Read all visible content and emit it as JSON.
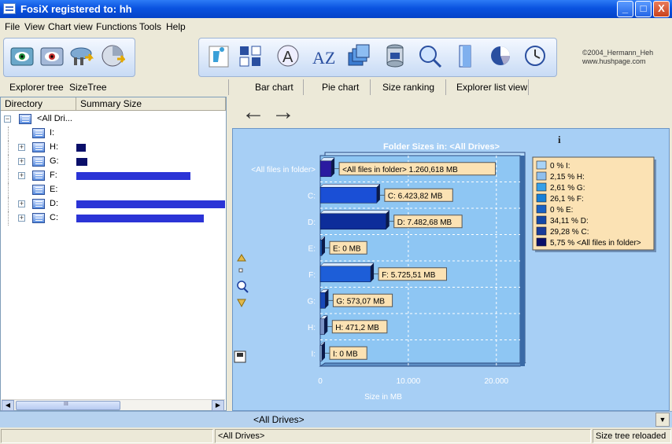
{
  "window": {
    "title": "FosiX registered to: hh",
    "minimize": "_",
    "maximize": "□",
    "close": "X"
  },
  "menu": [
    "File",
    "View",
    "Chart view",
    "Functions",
    "Tools",
    "Help"
  ],
  "toolbar": {
    "copyright_line1": "©2004_Hermann_Heh",
    "copyright_line2": "www.hushpage.com"
  },
  "left_tabs": [
    "Explorer tree",
    "SizeTree"
  ],
  "right_tabs": [
    "Bar chart",
    "Pie chart",
    "Size ranking",
    "Explorer list view"
  ],
  "tree": {
    "columns": [
      "Directory",
      "Summary Size"
    ],
    "root": "<All Dri...",
    "items": [
      {
        "label": "I:",
        "expander": "",
        "fraction": 0
      },
      {
        "label": "H:",
        "expander": "+",
        "fraction": 0.0215
      },
      {
        "label": "G:",
        "expander": "+",
        "fraction": 0.0261
      },
      {
        "label": "F:",
        "expander": "+",
        "fraction": 0.261
      },
      {
        "label": "E:",
        "expander": "",
        "fraction": 0
      },
      {
        "label": "D:",
        "expander": "+",
        "fraction": 0.3411
      },
      {
        "label": "C:",
        "expander": "+",
        "fraction": 0.2928
      }
    ],
    "expander_root": "−",
    "scroll_center": "III"
  },
  "nav": {
    "back": "←",
    "forward": "→"
  },
  "info_glyph": "i",
  "chart_data": {
    "type": "bar",
    "orientation": "horizontal",
    "title": "Folder Sizes in: <All Drives>",
    "xlabel": "Size in MB",
    "xlim": [
      0,
      22700
    ],
    "xticks": [
      0,
      10000,
      20000
    ],
    "xtick_labels": [
      "0",
      "10.000",
      "20.000"
    ],
    "categories": [
      "<All files in folder>",
      "C:",
      "D:",
      "E:",
      "F:",
      "G:",
      "H:",
      "I:"
    ],
    "values": [
      1260.618,
      6423.82,
      7482.68,
      0,
      5725.51,
      573.07,
      471.2,
      0
    ],
    "value_labels": [
      "<All files in folder> 1.260,618 MB",
      "C: 6.423,82 MB",
      "D: 7.482,68 MB",
      "E: 0 MB",
      "F: 5.725,51 MB",
      "G: 573,07 MB",
      "H: 471,2 MB",
      "I: 0 MB"
    ],
    "colors": [
      "#2a1aa0",
      "#1a4fd6",
      "#0d2d9a",
      "#1b66c9",
      "#1d5ed8",
      "#1848b8",
      "#7a93c7",
      "#9fc6f0"
    ],
    "grid": true,
    "legend_position": "right",
    "legend": [
      {
        "label": "0 % I:",
        "color": "#a8d3f7"
      },
      {
        "label": "2,15 % H:",
        "color": "#8fc0ee"
      },
      {
        "label": "2,61 % G:",
        "color": "#36a0e8"
      },
      {
        "label": "26,1 % F:",
        "color": "#1680d8"
      },
      {
        "label": "0 % E:",
        "color": "#1a62c4"
      },
      {
        "label": "34,11 % D:",
        "color": "#1448a8"
      },
      {
        "label": "29,28 % C:",
        "color": "#1a3c9a"
      },
      {
        "label": "5,75 % <All files in folder>",
        "color": "#0a0f6a"
      }
    ]
  },
  "bottom": {
    "combo_value": "<All Drives>",
    "combo_arrow": "▼"
  },
  "status": {
    "path": "<All Drives>",
    "message": "Size tree reloaded"
  }
}
